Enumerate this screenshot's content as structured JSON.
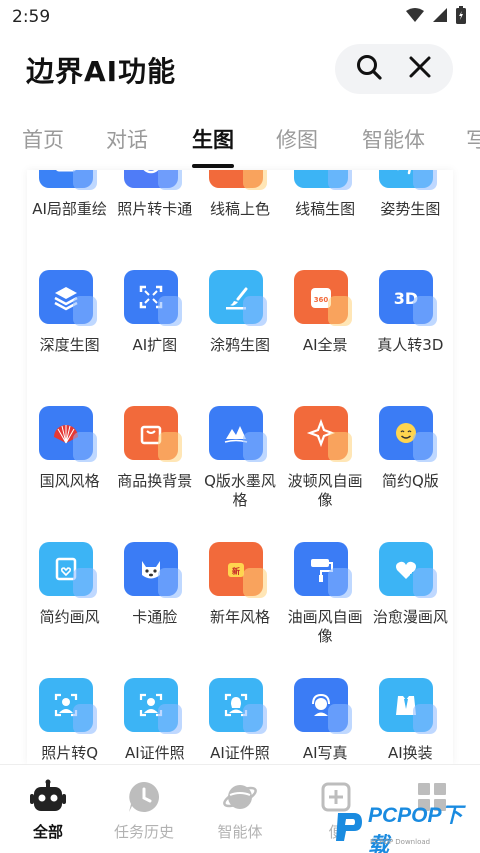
{
  "status": {
    "time": "2:59"
  },
  "header": {
    "title": "边界AI功能"
  },
  "tabs": [
    {
      "label": "首页"
    },
    {
      "label": "对话"
    },
    {
      "label": "生图"
    },
    {
      "label": "修图"
    },
    {
      "label": "智能体"
    },
    {
      "label": "写"
    }
  ],
  "grid": [
    {
      "label": "AI局部重绘",
      "icon": "frame-icon",
      "color": "#3b82f6"
    },
    {
      "label": "照片转卡通",
      "icon": "cat-face-icon",
      "color": "#4f7cf7"
    },
    {
      "label": "线稿上色",
      "icon": "palette-icon",
      "color": "#f26a3b"
    },
    {
      "label": "线稿生图",
      "icon": "line-art-icon",
      "color": "#3cb4f5"
    },
    {
      "label": "姿势生图",
      "icon": "running-icon",
      "color": "#3cb4f5"
    },
    {
      "label": "深度生图",
      "icon": "layers-icon",
      "color": "#3b7cf5"
    },
    {
      "label": "AI扩图",
      "icon": "expand-icon",
      "color": "#3b7cf5"
    },
    {
      "label": "涂鸦生图",
      "icon": "brush-icon",
      "color": "#3cb4f5"
    },
    {
      "label": "AI全景",
      "icon": "panorama-360-icon",
      "color": "#f26a3b"
    },
    {
      "label": "真人转3D",
      "icon": "3d-icon",
      "color": "#3b7cf5"
    },
    {
      "label": "国风风格",
      "icon": "fan-icon",
      "color": "#3b7cf5"
    },
    {
      "label": "商品换背景",
      "icon": "shopping-bag-icon",
      "color": "#f26a3b"
    },
    {
      "label": "Q版水墨风格",
      "icon": "ink-mountain-icon",
      "color": "#3b7cf5"
    },
    {
      "label": "波顿风自画像",
      "icon": "sparkle-icon",
      "color": "#f26a3b"
    },
    {
      "label": "简约Q版",
      "icon": "smiley-icon",
      "color": "#3b7cf5"
    },
    {
      "label": "简约画风",
      "icon": "picture-heart-icon",
      "color": "#3cb4f5"
    },
    {
      "label": "卡通脸",
      "icon": "dog-face-icon",
      "color": "#3b7cf5"
    },
    {
      "label": "新年风格",
      "icon": "new-year-icon",
      "color": "#f26a3b"
    },
    {
      "label": "油画风自画像",
      "icon": "paint-roller-icon",
      "color": "#3b7cf5"
    },
    {
      "label": "治愈漫画风",
      "icon": "heart-plus-icon",
      "color": "#3cb4f5"
    },
    {
      "label": "照片转Q",
      "icon": "portrait-scan-icon",
      "color": "#3cb4f5"
    },
    {
      "label": "AI证件照",
      "icon": "id-photo-icon",
      "color": "#3cb4f5"
    },
    {
      "label": "AI证件照",
      "icon": "id-photo-female-icon",
      "color": "#3cb4f5"
    },
    {
      "label": "AI写真",
      "icon": "headset-portrait-icon",
      "color": "#3b7cf5"
    },
    {
      "label": "AI换装",
      "icon": "suit-icon",
      "color": "#3cb4f5"
    }
  ],
  "bottom_nav": [
    {
      "label": "全部",
      "icon": "robot-icon"
    },
    {
      "label": "任务历史",
      "icon": "clock-icon"
    },
    {
      "label": "智能体",
      "icon": "planet-icon"
    },
    {
      "label": "便",
      "icon": "add-square-icon"
    },
    {
      "label": "",
      "icon": "grid-icon"
    }
  ],
  "watermark": {
    "text": "PCPOP下载",
    "sub": "PCPOP Download"
  }
}
